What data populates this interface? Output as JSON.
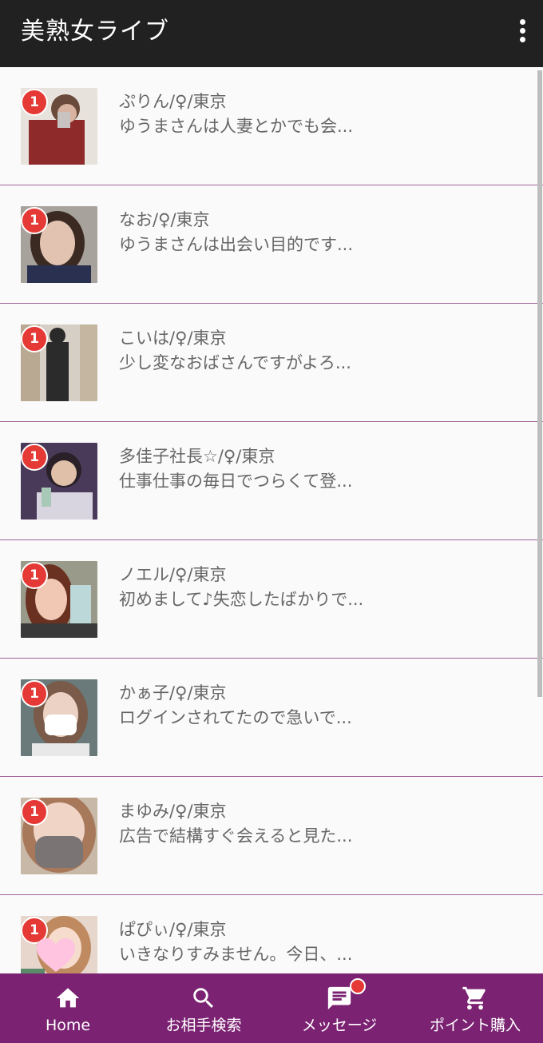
{
  "app": {
    "title": "美熟女ライブ"
  },
  "badge_color": "#e53935",
  "accent": "#7b2272",
  "conversations": [
    {
      "name": "ぷりん/♀/東京",
      "preview": "ゆうまさんは人妻とかでも会...",
      "unread": "1"
    },
    {
      "name": "なお/♀/東京",
      "preview": "ゆうまさんは出会い目的です...",
      "unread": "1"
    },
    {
      "name": "こいは/♀/東京",
      "preview": "少し変なおばさんですがよろ...",
      "unread": "1"
    },
    {
      "name": "多佳子社長☆/♀/東京",
      "preview": "仕事仕事の毎日でつらくて登...",
      "unread": "1"
    },
    {
      "name": "ノエル/♀/東京",
      "preview": "初めまして♪失恋したばかりで...",
      "unread": "1"
    },
    {
      "name": "かぁ子/♀/東京",
      "preview": "ログインされてたので急いで...",
      "unread": "1"
    },
    {
      "name": "まゆみ/♀/東京",
      "preview": "広告で結構すぐ会えると見た...",
      "unread": "1"
    },
    {
      "name": "ぱぴぃ/♀/東京",
      "preview": "いきなりすみません。今日、...",
      "unread": "1"
    }
  ],
  "nav": {
    "home": "Home",
    "search": "お相手検索",
    "messages": "メッセージ",
    "points": "ポイント購入"
  }
}
